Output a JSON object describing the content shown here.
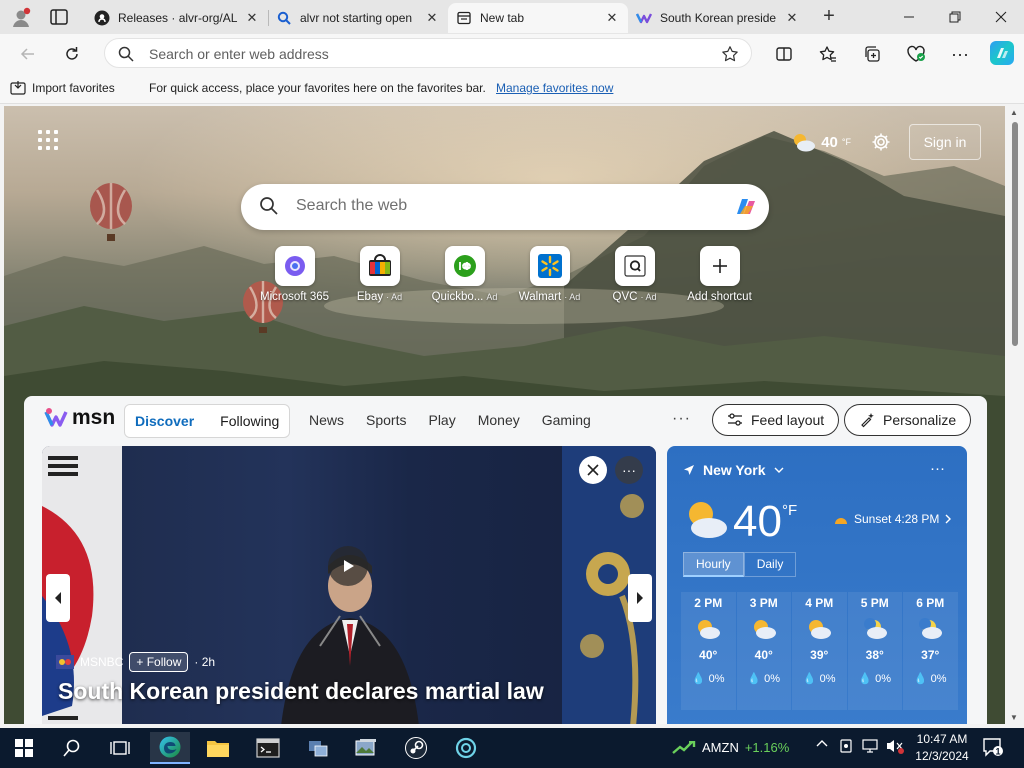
{
  "browser": {
    "tabs": [
      {
        "title": "Releases · alvr-org/AL",
        "icon": "github-icon",
        "active": false
      },
      {
        "title": "alvr not starting open",
        "icon": "search-icon",
        "active": false
      },
      {
        "title": "New tab",
        "icon": "newtab-icon",
        "active": true
      },
      {
        "title": "South Korean preside",
        "icon": "msn-icon",
        "active": false
      }
    ],
    "address_placeholder": "Search or enter web address",
    "favorites_bar": {
      "import_label": "Import favorites",
      "message": "For quick access, place your favorites here on the favorites bar.",
      "manage_link": "Manage favorites now"
    }
  },
  "newtab": {
    "weather_temp": "40",
    "weather_unit": "°F",
    "signin_label": "Sign in",
    "search_placeholder": "Search the web",
    "shortcuts": [
      {
        "label": "Microsoft 365",
        "ad": "",
        "icon": "microsoft365-icon"
      },
      {
        "label": "Ebay",
        "ad": "· Ad",
        "icon": "ebay-icon"
      },
      {
        "label": "Quickbo...",
        "ad": "Ad",
        "icon": "quickbooks-icon"
      },
      {
        "label": "Walmart",
        "ad": "· Ad",
        "icon": "walmart-icon"
      },
      {
        "label": "QVC",
        "ad": "· Ad",
        "icon": "qvc-icon"
      },
      {
        "label": "Add shortcut",
        "ad": "",
        "icon": "plus-icon"
      }
    ]
  },
  "feed": {
    "logo_text": "msn",
    "tabs": [
      "Discover",
      "Following"
    ],
    "categories": [
      "News",
      "Sports",
      "Play",
      "Money",
      "Gaming"
    ],
    "more_label": "···",
    "feed_layout_label": "Feed layout",
    "personalize_label": "Personalize",
    "hero": {
      "source": "MSNBC",
      "follow_label": "Follow",
      "age": "· 2h",
      "headline": "South Korean president declares martial law"
    },
    "weather": {
      "location": "New York",
      "temp": "40",
      "unit": "°F",
      "sunset": "Sunset 4:28 PM",
      "tabs": [
        "Hourly",
        "Daily"
      ],
      "hours": [
        {
          "time": "2 PM",
          "temp": "40°",
          "precip": "0%"
        },
        {
          "time": "3 PM",
          "temp": "40°",
          "precip": "0%"
        },
        {
          "time": "4 PM",
          "temp": "39°",
          "precip": "0%"
        },
        {
          "time": "5 PM",
          "temp": "38°",
          "precip": "0%"
        },
        {
          "time": "6 PM",
          "temp": "37°",
          "precip": "0%"
        }
      ]
    }
  },
  "taskbar": {
    "stock_symbol": "AMZN",
    "stock_change": "+1.16%",
    "time": "10:47 AM",
    "date": "12/3/2024",
    "notification_count": "1"
  }
}
